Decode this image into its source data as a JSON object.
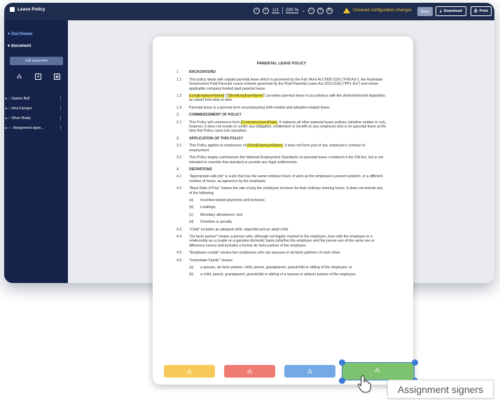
{
  "app": {
    "title": "Leave Policy",
    "page_indicator": "1/1",
    "zoom": "200 %",
    "warning": "Unsaved configuration changes",
    "save_label": "Save",
    "download_label": "Download",
    "print_label": "Print"
  },
  "sidebar": {
    "title": "DocViewer",
    "doc_label": "document",
    "edit_properties_label": "Edit properties",
    "tool_icons": [
      "magic-wand-icon",
      "text-field-icon",
      "date-field-icon"
    ],
    "items": [
      {
        "label": "Gaston Bell"
      },
      {
        "label": "Irina Fayngor"
      },
      {
        "label": "Oliver Brady"
      },
      {
        "label": "Assignment signe..."
      }
    ]
  },
  "document": {
    "title": "PARENTAL LEAVE POLICY",
    "sections": [
      {
        "num": "1.",
        "text": "BACKGROUND",
        "heading": true
      },
      {
        "num": "1.1",
        "text": "This policy deals with unpaid parental leave which is governed by the Fair Work Act 2009 (Cth) (\"FW Act\"), the Australian Government Paid Parental Leave scheme governed by the Paid Parental Leave Act 2010 (Cth) (\"PPL Act\") and where applicable company funded paid parental leave."
      },
      {
        "num": "1.2",
        "pre": "",
        "hl1": "[LongEmployerName]",
        "mid": " (\"",
        "hl2": "[ShortEmployerName]",
        "post": "\") provides parental leave in accordance with the aforementioned legislation, as varied from time to time."
      },
      {
        "num": "1.3",
        "text": "Parental leave is a general term encompassing birth-related and adoption-related leave."
      },
      {
        "num": "2.",
        "text": "COMMENCEMENT OF POLICY",
        "heading": true
      },
      {
        "num": "2.1",
        "pre": "This Policy will commence from ",
        "hl1": "[CommencementDate]",
        "post": ". It replaces all other parental leave policies (whether written or not), however, it does not create or confer any obligation, entitlement or benefit on any employee who is on parental leave at the time this Policy came into operation."
      },
      {
        "num": "3.",
        "text": "APPLICATION OF THIS POLICY",
        "heading": true
      },
      {
        "num": "3.1",
        "pre": "This Policy applies to employees of ",
        "hl1": "[ShortEmployerName]",
        "post": ". It does not form part of any employee's contract of employment."
      },
      {
        "num": "3.2",
        "text": "This Policy largely summarises the National Employment Standards on parental leave contained in the FW Act, but is not intended to override that standard or provide any legal entitlements."
      },
      {
        "num": "4.",
        "text": "DEFINITIONS",
        "heading": true
      },
      {
        "num": "4.1",
        "text": "\"Appropriate safe job\" is a job that has the same ordinary hours of work as the employee's present position, or a different number of hours, as agreed to by the employee."
      },
      {
        "num": "4.2",
        "text": "\"Base Rate of Pay\" means the rate of pay the employee receives for their ordinary working hours. It does not include any of the following:"
      },
      {
        "num": "(a)",
        "text": "Incentive based payments and bonuses;",
        "sub": true
      },
      {
        "num": "(b)",
        "text": "Loadings;",
        "sub": true
      },
      {
        "num": "(c)",
        "text": "Monetary allowances; and",
        "sub": true
      },
      {
        "num": "(d)",
        "text": "Overtime or penalty.",
        "sub": true
      },
      {
        "num": "4.3",
        "text": "\"Child\" includes an adopted child, stepchild and an adult child."
      },
      {
        "num": "4.4",
        "text": "\"De facto partner\" means a person who, although not legally married to the employee, lives with the employee in a relationship as a couple on a genuine domestic basis (whether the employee and the person are of the same sex or difference sexes) and includes a former de facto partner of the employee."
      },
      {
        "num": "4.5",
        "text": "\"Employee couple\" means two employees who are spouses or de facto partners of each other."
      },
      {
        "num": "4.6",
        "text": "\"Immediate Family\" means:"
      },
      {
        "num": "(a)",
        "text": "a spouse, de facto partner, child, parent, grandparent, grandchild or sibling of the employee; or",
        "sub": true
      },
      {
        "num": "(b)",
        "text": "a child, parent, grandparent, grandchild or sibling of a spouse or defacto partner of the employee.",
        "sub": true
      }
    ]
  },
  "tool_buttons": [
    {
      "color": "#f6c95a",
      "icon": "magic-wand-icon"
    },
    {
      "color": "#f07b72",
      "icon": "magic-wand-icon"
    },
    {
      "color": "#74a9e6",
      "icon": "magic-wand-icon"
    },
    {
      "color": "#7dc36f",
      "icon": "magic-wand-icon"
    }
  ],
  "tooltip": "Assignment signers"
}
